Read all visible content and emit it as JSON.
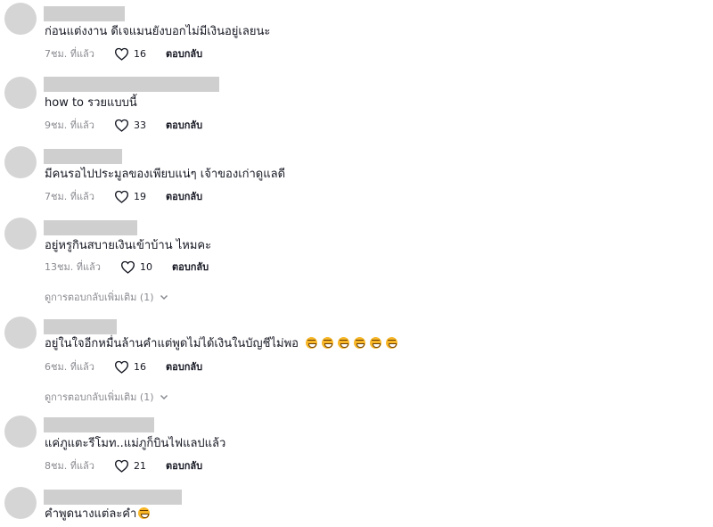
{
  "reply_label": "ตอบกลับ",
  "comments": [
    {
      "text": "ก่อนแต่งงาน ดีเจแมนยังบอกไม่มีเงินอยู่เลยนะ",
      "time": "7ชม. ที่แล้ว",
      "likes": "16"
    },
    {
      "text": "how to รวยแบบนี้",
      "time": "9ชม. ที่แล้ว",
      "likes": "33"
    },
    {
      "text": "มีคนรอไปประมูลของเพียบแน่ๆ เจ้าของเก่าดูแลดี",
      "time": "7ชม. ที่แล้ว",
      "likes": "19"
    },
    {
      "text": "อยู่หรูกินสบายเงินเข้าบ้าน ไหมคะ",
      "time": "13ชม. ที่แล้ว",
      "likes": "10",
      "more": "ดูการตอบกลับเพิ่มเติม (1)"
    },
    {
      "text": "อยู่ในใจอีกหมื่นล้านคำแต่พูดไม่ได้เงินในบัญชีไม่พอ",
      "emoji_count": 6,
      "time": "6ชม. ที่แล้ว",
      "likes": "16",
      "more": "ดูการตอบกลับเพิ่มเติม (1)"
    },
    {
      "text": "แค่ภูแตะรีโมท..แม่ภูก็บินไฟแลปแล้ว",
      "time": "8ชม. ที่แล้ว",
      "likes": "21"
    },
    {
      "text": "คำพูดนางแต่ละคำ",
      "emoji_count": 1
    }
  ],
  "icons": {
    "like": "heart-outline-icon",
    "expand": "chevron-down-icon",
    "emoji": "grinning-face-emoji"
  },
  "colors": {
    "avatar": "#d5d5d5",
    "username_placeholder": "#cfcfcf",
    "meta_text": "#8a8b91",
    "emoji": "#f6b627"
  }
}
